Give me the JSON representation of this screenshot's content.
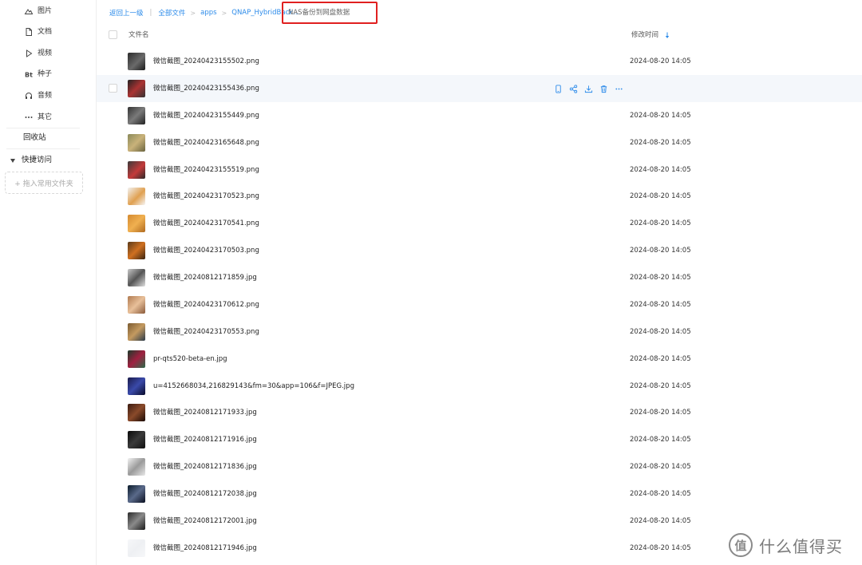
{
  "sidebar": {
    "items": [
      {
        "label": "图片",
        "icon": "cloud-image-icon"
      },
      {
        "label": "文档",
        "icon": "document-icon"
      },
      {
        "label": "视频",
        "icon": "play-icon"
      },
      {
        "label": "种子",
        "icon": "bt-icon"
      },
      {
        "label": "音频",
        "icon": "headphones-icon"
      },
      {
        "label": "其它",
        "icon": "more-icon"
      }
    ],
    "recycle_label": "回收站",
    "quick_access_label": "快捷访问",
    "pin_folder_label": "+ 拖入常用文件夹"
  },
  "breadcrumb": {
    "back_label": "返回上一级",
    "all_files_label": "全部文件",
    "apps_label": "apps",
    "hybrid_label": "QNAP_HybridBack...",
    "current_label": "NAS备份到网盘数据"
  },
  "table": {
    "col_name": "文件名",
    "col_time": "修改时间",
    "rows": [
      {
        "name": "微信截图_20240423155502.png",
        "time": "2024-08-20 14:05"
      },
      {
        "name": "微信截图_20240423155436.png",
        "time": ""
      },
      {
        "name": "微信截图_20240423155449.png",
        "time": "2024-08-20 14:05"
      },
      {
        "name": "微信截图_20240423165648.png",
        "time": "2024-08-20 14:05"
      },
      {
        "name": "微信截图_20240423155519.png",
        "time": "2024-08-20 14:05"
      },
      {
        "name": "微信截图_20240423170523.png",
        "time": "2024-08-20 14:05"
      },
      {
        "name": "微信截图_20240423170541.png",
        "time": "2024-08-20 14:05"
      },
      {
        "name": "微信截图_20240423170503.png",
        "time": "2024-08-20 14:05"
      },
      {
        "name": "微信截图_20240812171859.jpg",
        "time": "2024-08-20 14:05"
      },
      {
        "name": "微信截图_20240423170612.png",
        "time": "2024-08-20 14:05"
      },
      {
        "name": "微信截图_20240423170553.png",
        "time": "2024-08-20 14:05"
      },
      {
        "name": "pr-qts520-beta-en.jpg",
        "time": "2024-08-20 14:05"
      },
      {
        "name": "u=4152668034,216829143&fm=30&app=106&f=JPEG.jpg",
        "time": "2024-08-20 14:05"
      },
      {
        "name": "微信截图_20240812171933.jpg",
        "time": "2024-08-20 14:05"
      },
      {
        "name": "微信截图_20240812171916.jpg",
        "time": "2024-08-20 14:05"
      },
      {
        "name": "微信截图_20240812171836.jpg",
        "time": "2024-08-20 14:05"
      },
      {
        "name": "微信截图_20240812172038.jpg",
        "time": "2024-08-20 14:05"
      },
      {
        "name": "微信截图_20240812172001.jpg",
        "time": "2024-08-20 14:05"
      },
      {
        "name": "微信截图_20240812171946.jpg",
        "time": "2024-08-20 14:05"
      }
    ]
  },
  "watermark": {
    "logo": "值",
    "text": "什么值得买"
  },
  "colors": {
    "link": "#2e8cea",
    "highlight_border": "#e02020",
    "hover_row": "#f4f7fb"
  }
}
